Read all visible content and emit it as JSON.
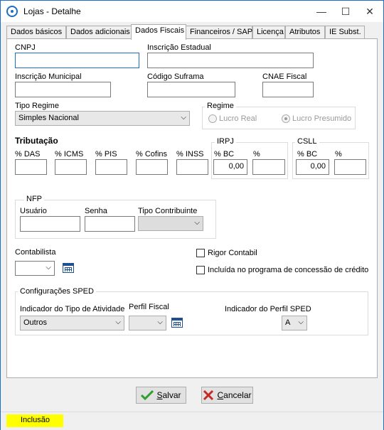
{
  "window": {
    "title": "Lojas - Detalhe",
    "minimize": "—",
    "maximize": "☐",
    "close": "✕"
  },
  "tabs": [
    {
      "label": "Dados básicos"
    },
    {
      "label": "Dados adicionais"
    },
    {
      "label": "Dados Fiscais"
    },
    {
      "label": "Financeiros / SAP"
    },
    {
      "label": "Licença"
    },
    {
      "label": "Atributos"
    },
    {
      "label": "IE Subst."
    }
  ],
  "fields": {
    "cnpj": {
      "label": "CNPJ",
      "value": ""
    },
    "inscricao_estadual": {
      "label": "Inscrição Estadual",
      "value": ""
    },
    "inscricao_municipal": {
      "label": "Inscrição Municipal",
      "value": ""
    },
    "codigo_suframa": {
      "label": "Código Suframa",
      "value": ""
    },
    "cnae_fiscal": {
      "label": "CNAE Fiscal",
      "value": ""
    },
    "tipo_regime": {
      "label": "Tipo Regime",
      "value": "Simples Nacional"
    }
  },
  "regime": {
    "title": "Regime",
    "options": [
      {
        "label": "Lucro Real",
        "checked": false
      },
      {
        "label": "Lucro Presumido",
        "checked": true
      }
    ]
  },
  "tributacao": {
    "title": "Tributação",
    "labels": [
      "% DAS",
      "% ICMS",
      "% PIS",
      "% Cofins",
      "% INSS"
    ],
    "irpj": {
      "title": "IRPJ",
      "bc_label": "% BC",
      "pct_label": "%",
      "bc_value": "0,00",
      "pct_value": ""
    },
    "csll": {
      "title": "CSLL",
      "bc_label": "% BC",
      "pct_label": "%",
      "bc_value": "0,00",
      "pct_value": ""
    }
  },
  "nfp": {
    "title": "NFP",
    "usuario_label": "Usuário",
    "senha_label": "Senha",
    "tipo_contribuinte_label": "Tipo Contribuinte"
  },
  "contabilista": {
    "label": "Contabilista",
    "value": ""
  },
  "checkboxes": {
    "rigor_contabil": {
      "label": "Rigor Contabil",
      "checked": false
    },
    "incluida_programa": {
      "label": "Incluída no programa de concessão de crédito",
      "checked": false
    }
  },
  "sped": {
    "title": "Configurações SPED",
    "tipo_atividade_label": "Indicador do Tipo de Atividade",
    "tipo_atividade_value": "Outros",
    "perfil_fiscal_label": "Perfil Fiscal",
    "perfil_fiscal_value": "",
    "indicador_perfil_label": "Indicador do Perfil SPED",
    "indicador_perfil_value": "A"
  },
  "buttons": {
    "salvar_underlined": "S",
    "salvar_rest": "alvar",
    "cancelar_underlined": "C",
    "cancelar_rest": "ancelar"
  },
  "status": {
    "mode": "Inclusão"
  },
  "colors": {
    "accent": "#1e6ec8",
    "status_highlight": "#ffff00",
    "check_green": "#2e9e2e",
    "cancel_red": "#c62828"
  }
}
